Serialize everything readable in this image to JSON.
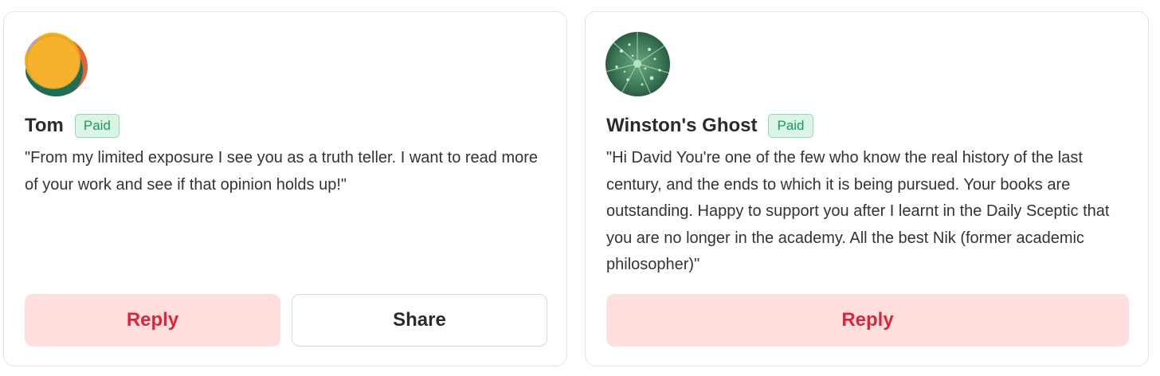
{
  "cards": [
    {
      "name": "Tom",
      "badge": "Paid",
      "quote": "\"From my limited exposure I see you as a truth teller. I want to read more of your work and see if that opinion holds up!\"",
      "buttons": {
        "reply": "Reply",
        "share": "Share"
      },
      "avatar_icon": "abstract-orange-circle-avatar"
    },
    {
      "name": "Winston's Ghost",
      "badge": "Paid",
      "quote": "\"Hi David You're one of the few who know the real history of the last century, and the ends to which it is being pursued. Your books are outstanding. Happy to support you after I learnt in the Daily Sceptic that you are no longer in the academy. All the best Nik (former academic philosopher)\"",
      "buttons": {
        "reply": "Reply"
      },
      "avatar_icon": "green-leaf-water-drops-avatar"
    }
  ],
  "colors": {
    "reply_bg": "#ffdede",
    "reply_text": "#d8273a",
    "badge_bg": "#daf5e6",
    "badge_text": "#1c9a5b"
  }
}
